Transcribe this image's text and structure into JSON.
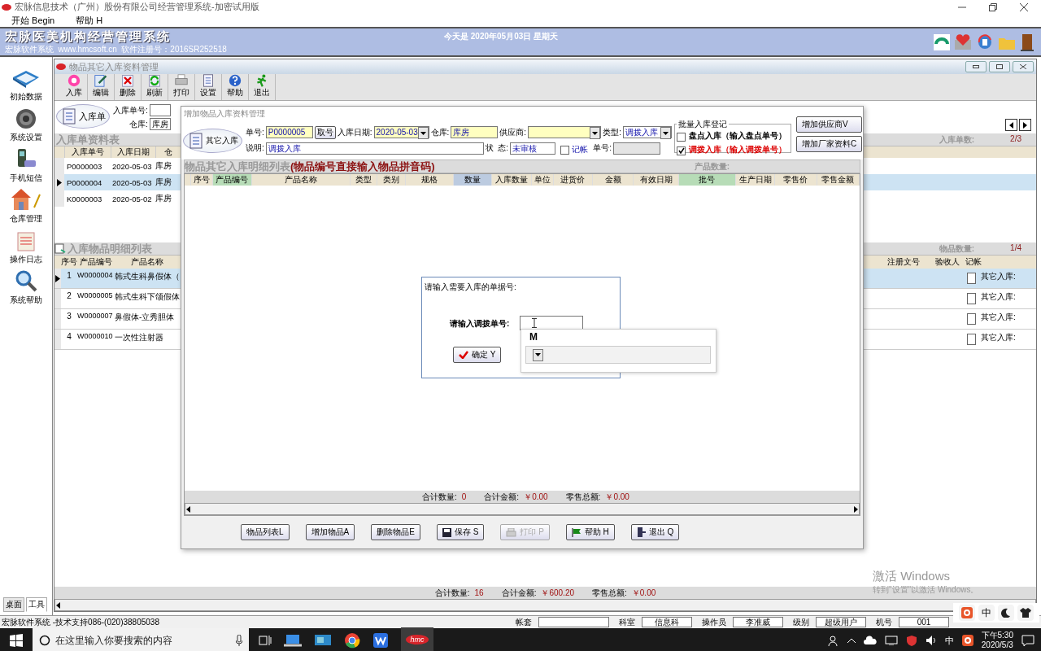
{
  "app": {
    "title": "宏脉信息技术（广州）股份有限公司经营管理系统-加密试用版"
  },
  "menu": [
    {
      "label": "开始 Begin"
    },
    {
      "label": "帮助 H"
    }
  ],
  "banner": {
    "title": "宏脉医美机构经营管理系统",
    "subtitle": "宏脉软件系统  www.hmcsoft.cn  软件注册号：2016SR252518",
    "date": "今天是 2020年05月03日  星期天"
  },
  "sidebar": {
    "items": [
      {
        "label": "初始数据"
      },
      {
        "label": "系统设置"
      },
      {
        "label": "手机短信"
      },
      {
        "label": "仓库管理"
      },
      {
        "label": "操作日志"
      },
      {
        "label": "系统帮助"
      }
    ],
    "tabs": [
      {
        "label": "桌面",
        "selected": false
      },
      {
        "label": "工具",
        "selected": true
      }
    ]
  },
  "child": {
    "title": "物品其它入库资料管理",
    "toolbar": [
      "入库",
      "编辑",
      "删除",
      "刷新",
      "打印",
      "设置",
      "帮助",
      "退出"
    ],
    "filter": {
      "badge": "入库单",
      "order_label": "入库单号:",
      "warehouse_label": "仓库:",
      "warehouse_value": "库房"
    },
    "orders": {
      "title": "入库单资料表",
      "count_label": "入库单数:",
      "count": "2/3",
      "columns": [
        "入库单号",
        "入库日期",
        "仓"
      ],
      "rows": [
        {
          "cells": [
            "P0000003",
            "2020-05-03",
            "库房"
          ],
          "selected": false
        },
        {
          "cells": [
            "P0000004",
            "2020-05-03",
            "库房"
          ],
          "selected": true
        },
        {
          "cells": [
            "K0000003",
            "2020-05-02",
            "库房"
          ],
          "selected": false
        }
      ]
    },
    "items": {
      "title": "入库物品明细列表",
      "count_label": "物品数量:",
      "count": "1/4",
      "columns_left": [
        "序号",
        "产品编号",
        "产品名称"
      ],
      "columns_right": [
        "注册文号",
        "验收人",
        "记帐"
      ],
      "rows": [
        {
          "no": "1",
          "code": "W0000004",
          "name": "韩式生科鼻假体（",
          "posted": false,
          "type": "其它入库:",
          "selected": true
        },
        {
          "no": "2",
          "code": "W0000005",
          "name": "韩式生科下颌假体",
          "posted": false,
          "type": "其它入库:",
          "selected": false
        },
        {
          "no": "3",
          "code": "W0000007",
          "name": "鼻假体-立秀胆体",
          "posted": false,
          "type": "其它入库:",
          "selected": false
        },
        {
          "no": "4",
          "code": "W0000010",
          "name": "一次性注射器",
          "posted": false,
          "type": "其它入库:",
          "selected": false
        }
      ]
    },
    "totals": [
      {
        "label": "合计数量:",
        "value": "16"
      },
      {
        "label": "合计金额:",
        "value": "￥600.20"
      },
      {
        "label": "零售总额:",
        "value": "￥0.00"
      }
    ]
  },
  "dialog": {
    "title": "增加物品入库资料管理",
    "badge": "其它入库",
    "order_no": {
      "label": "单号:",
      "value": "P0000005"
    },
    "fetch_button": "取号",
    "date": {
      "label": "入库日期:",
      "value": "2020-05-03"
    },
    "warehouse": {
      "label": "仓库:",
      "value": "库房"
    },
    "supplier": {
      "label": "供应商:"
    },
    "type": {
      "label": "类型:",
      "value": "调拨入库"
    },
    "note": {
      "label": "说明:",
      "value": "调拨入库"
    },
    "status": {
      "label": "状  态:",
      "value": "未审核"
    },
    "posted": {
      "label": "记帐",
      "checked": false
    },
    "ref_no": {
      "label": "单号:"
    },
    "batch": {
      "title": "批量入库登记",
      "options": [
        {
          "label": "盘点入库（输入盘点单号）",
          "checked": false
        },
        {
          "label": "调拨入库（输入调拨单号）",
          "checked": true
        }
      ]
    },
    "side_buttons": [
      "增加供应商V",
      "增加厂家资料C"
    ],
    "detail": {
      "title": "物品其它入库明细列表",
      "hint": "(物品编号直接输入物品拼音码)",
      "count_label": "产品数量:",
      "columns": [
        {
          "label": "序号",
          "color": "#ece4d0"
        },
        {
          "label": "产品编号",
          "color": "#b7dcb7"
        },
        {
          "label": "产品名称",
          "color": "#ece4d0"
        },
        {
          "label": "类型",
          "color": "#ece4d0"
        },
        {
          "label": "类别",
          "color": "#ece4d0"
        },
        {
          "label": "规格",
          "color": "#ece4d0"
        },
        {
          "label": "数量",
          "color": "#bccbe0"
        },
        {
          "label": "入库数量",
          "color": "#ece4d0"
        },
        {
          "label": "单位",
          "color": "#ece4d0"
        },
        {
          "label": "进货价",
          "color": "#ece4d0"
        },
        {
          "label": "金额",
          "color": "#ece4d0"
        },
        {
          "label": "有效日期",
          "color": "#ece4d0"
        },
        {
          "label": "批号",
          "color": "#b7dcb7"
        },
        {
          "label": "生产日期",
          "color": "#ece4d0"
        },
        {
          "label": "零售价",
          "color": "#ece4d0"
        },
        {
          "label": "零售金额",
          "color": "#ece4d0"
        }
      ]
    },
    "totals": [
      {
        "label": "合计数量:",
        "value": "0"
      },
      {
        "label": "合计金额:",
        "value": "￥0.00"
      },
      {
        "label": "零售总额:",
        "value": "￥0.00"
      }
    ],
    "buttons": [
      {
        "label": "物品列表L",
        "kind": "text",
        "disabled": false
      },
      {
        "label": "增加物品A",
        "kind": "text",
        "disabled": false
      },
      {
        "label": "删除物品E",
        "kind": "text",
        "disabled": false
      },
      {
        "label": "保存 S",
        "kind": "save",
        "disabled": false
      },
      {
        "label": "打印 P",
        "kind": "print",
        "disabled": true
      },
      {
        "label": "帮助 H",
        "kind": "help",
        "disabled": false
      },
      {
        "label": "退出 Q",
        "kind": "exit",
        "disabled": false
      }
    ]
  },
  "prompt": {
    "caption": "请输入需要入库的单据号:",
    "label": "请输入调拨单号:",
    "ok": "确定 Y"
  },
  "popup": {
    "text": "M"
  },
  "activation": {
    "title": "激活 Windows",
    "hint": "转到\"设置\"以激活 Windows。"
  },
  "status_bar": {
    "vendor": "宏脉软件系统 -技术支持086-(020)38805038",
    "fields": [
      {
        "label": "帐套"
      },
      {
        "label": "科室",
        "value": "信息科"
      },
      {
        "label": "操作员",
        "value": "李准威"
      },
      {
        "label": "级别",
        "value": "超级用户"
      },
      {
        "label": "机号",
        "value": "001"
      }
    ]
  },
  "ime": {
    "mode": "中"
  },
  "taskbar": {
    "search_placeholder": "在这里输入你要搜索的内容",
    "app_label": "hmc",
    "tray_lang": "中",
    "time": "下午5:30",
    "date": "2020/5/3"
  }
}
